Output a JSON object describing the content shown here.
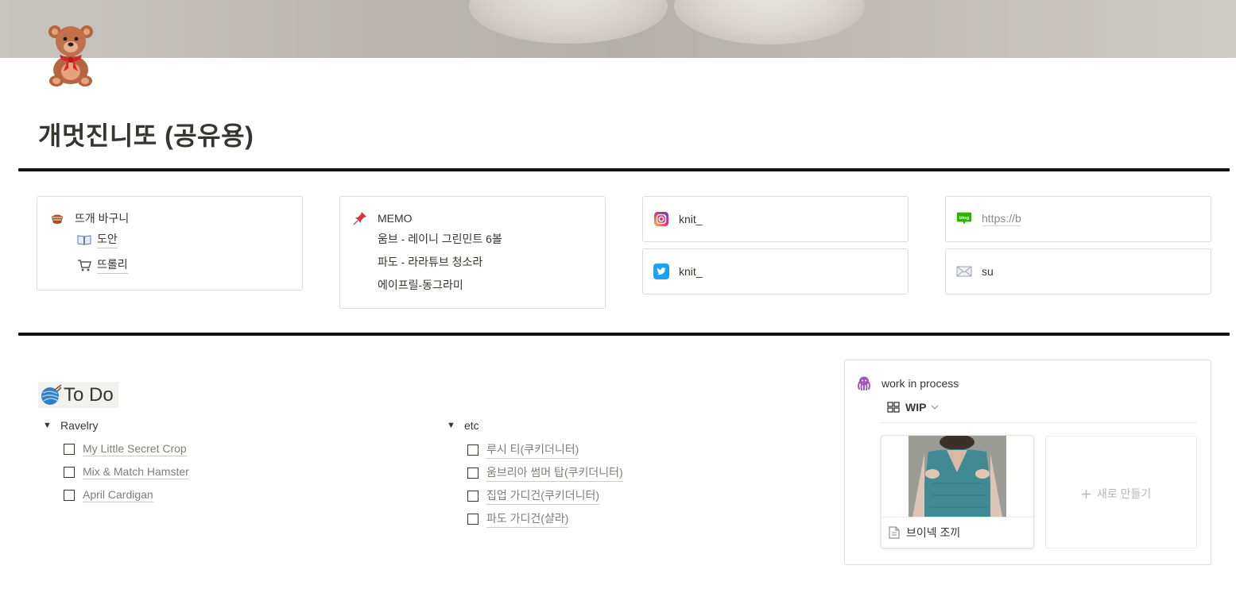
{
  "page": {
    "title": "개멋진니또 (공유용)",
    "cover": "knitted yarn cover photo",
    "icon": "teddy-bear-icon"
  },
  "basket": {
    "title": "뜨개 바구니",
    "items": [
      {
        "icon": "book-icon",
        "label": "도안"
      },
      {
        "icon": "shopping-cart-icon",
        "label": "뜨롤리"
      }
    ]
  },
  "memo": {
    "title": "MEMO",
    "lines": [
      "움브 - 레이니 그린민트 6볼",
      "파도 - 라라튜브 청소라",
      "에이프릴-동그라미"
    ]
  },
  "social": {
    "instagram": {
      "icon": "instagram-icon",
      "label": "knit_"
    },
    "twitter": {
      "icon": "twitter-icon",
      "label": "knit_"
    },
    "blog": {
      "icon": "blog-icon",
      "label": "https://b"
    },
    "mail": {
      "icon": "envelope-icon",
      "label": "su"
    }
  },
  "todo": {
    "heading": "To Do",
    "heading_icon": "yarn-ball-icon",
    "groups": [
      {
        "title": "Ravelry",
        "items": [
          "My Little Secret Crop",
          "Mix & Match Hamster",
          "April Cardigan"
        ]
      },
      {
        "title": "etc",
        "items": [
          "루시 티(쿠키더니터)",
          "움브리아 썸머 탑(쿠키더니터)",
          "집업 가디건(쿠키더니터)",
          "파도 가디건(샬라)"
        ]
      }
    ]
  },
  "wip": {
    "title": "work in process",
    "title_icon": "octopus-icon",
    "view_label": "WIP",
    "card_title": "브이넥 조끼",
    "new_label": "새로 만들기"
  },
  "colors": {
    "text": "#37352f",
    "border": "#dcdbd8",
    "divider": "#111111",
    "muted": "#8b8984"
  }
}
